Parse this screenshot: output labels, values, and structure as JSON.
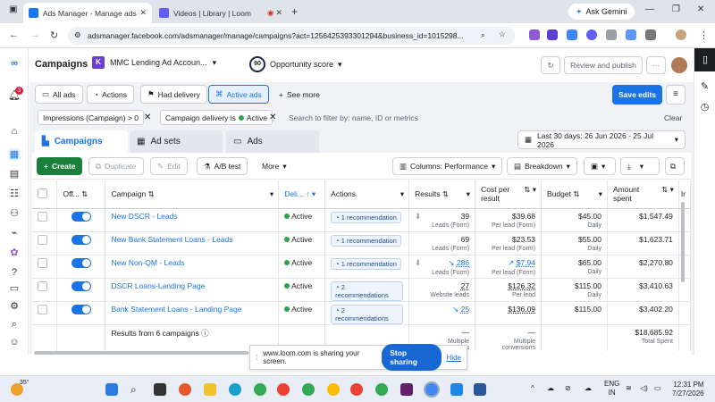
{
  "browser": {
    "tabs": [
      {
        "title": "Ads Manager - Manage ads - C",
        "active": true
      },
      {
        "title": "Videos | Library | Loom",
        "active": false
      }
    ],
    "url": "adsmanager.facebook.com/adsmanager/manage/campaigns?act=1256425393301294&business_id=1015298...",
    "gemini_label": "Ask Gemini"
  },
  "header": {
    "title": "Campaigns",
    "account_name": "MMC Lending Ad Accoun...",
    "opportunity_score_value": "90",
    "opportunity_score_label": "Opportunity score",
    "review_publish": "Review and publish",
    "more": "···"
  },
  "rail": {
    "notification_count": "3"
  },
  "filters": {
    "all_ads": "All ads",
    "actions": "Actions",
    "had_delivery": "Had delivery",
    "active_ads": "Active ads",
    "see_more": "See more",
    "save_edits": "Save edits"
  },
  "search": {
    "chip1": "Impressions (Campaign) > 0",
    "chip2_prefix": "Campaign delivery is",
    "chip2_value": "Active",
    "placeholder": "Search to filter by: name, ID or metrics",
    "clear": "Clear"
  },
  "levels": {
    "campaigns": "Campaigns",
    "ad_sets": "Ad sets",
    "ads": "Ads",
    "date_range": "Last 30 days: 26 Jun 2026 - 25 Jul 2026"
  },
  "toolbar": {
    "create": "Create",
    "duplicate": "Duplicate",
    "edit": "Edit",
    "ab_test": "A/B test",
    "more": "More",
    "columns": "Columns: Performance",
    "breakdown": "Breakdown"
  },
  "columns": {
    "off_on": "Off...",
    "campaign": "Campaign",
    "delivery": "Deli...",
    "actions": "Actions",
    "results": "Results",
    "cost_per_result": "Cost per result",
    "budget": "Budget",
    "amount_spent": "Amount spent",
    "impressions": "Ir"
  },
  "rows": [
    {
      "name": "New DSCR - Leads",
      "delivery": "Active",
      "rec": "1 recommendation",
      "results": "39",
      "results_sub": "Leads (Form)",
      "cost": "$39.68",
      "cost_sub": "Per lead (Form)",
      "budget": "$45.00",
      "budget_sub": "Daily",
      "spent": "$1,547.49"
    },
    {
      "name": "New Bank Statement Loans - Leads",
      "delivery": "Active",
      "rec": "1 recommendation",
      "results": "69",
      "results_sub": "Leads (Form)",
      "cost": "$23.53",
      "cost_sub": "Per lead (Form)",
      "budget": "$55.00",
      "budget_sub": "Daily",
      "spent": "$1,623.71"
    },
    {
      "name": "New Non-QM - Leads",
      "delivery": "Active",
      "rec": "1 recommendation",
      "results": "286",
      "results_sub": "Leads (Form)",
      "cost": "$7.94",
      "cost_sub": "Per lead (Form)",
      "budget": "$65.00",
      "budget_sub": "Daily",
      "spent": "$2,270.80"
    },
    {
      "name": "DSCR Loans-Landing Page",
      "delivery": "Active",
      "rec": "2 recommendations",
      "results": "27",
      "results_sub": "Website leads",
      "cost": "$126.32",
      "cost_sub": "Per lead",
      "budget": "$115.00",
      "budget_sub": "Daily",
      "spent": "$3,410.63"
    },
    {
      "name": "Bank Statement Loans - Landing Page",
      "delivery": "Active",
      "rec": "2 recommendations",
      "results": "25",
      "results_sub": "",
      "cost": "$136.09",
      "cost_sub": "",
      "budget": "$115.00",
      "budget_sub": "",
      "spent": "$3,402.20"
    }
  ],
  "totals": {
    "label": "Results from 6 campaigns",
    "results": "—",
    "results_sub": "Multiple conversions",
    "cost": "—",
    "cost_sub": "Multiple conversions",
    "spent": "$18,685.92",
    "spent_sub": "Total Spent"
  },
  "share_bar": {
    "message": "www.loom.com is sharing your screen.",
    "stop": "Stop sharing",
    "hide": "Hide"
  },
  "taskbar": {
    "weather": "35°",
    "lang1": "ENG",
    "lang2": "IN",
    "time": "12:31 PM",
    "date": "7/27/2026"
  },
  "colors": {
    "accent": "#1b74e4",
    "create": "#188038",
    "active_dot": "#31a24c",
    "notification": "#e41e3f"
  }
}
